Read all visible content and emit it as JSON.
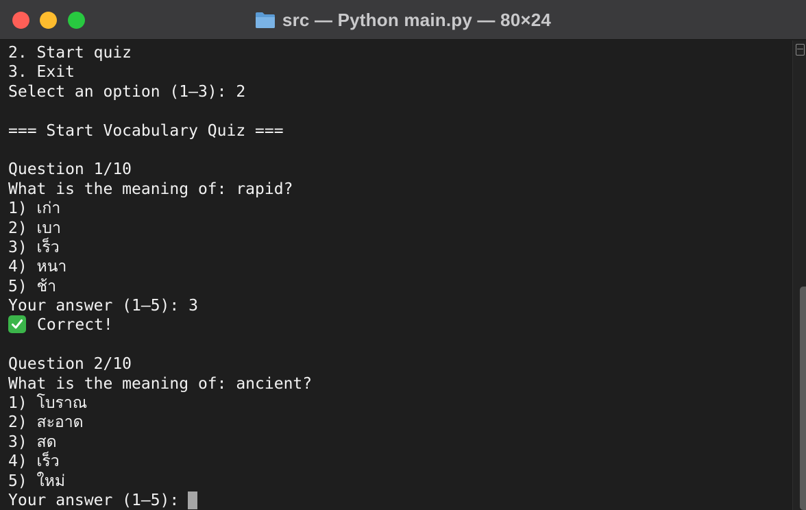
{
  "window": {
    "title": "src — Python main.py — 80×24",
    "icon": "folder-icon"
  },
  "colors": {
    "close": "#fe5f57",
    "minimize": "#febc2e",
    "zoom": "#28c840",
    "background": "#1e1e1e",
    "foreground": "#f2f2f2",
    "check": "#3bb54a"
  },
  "terminal": {
    "lines": [
      "2. Start quiz",
      "3. Exit",
      "Select an option (1–3): 2",
      "",
      "=== Start Vocabulary Quiz ===",
      "",
      "Question 1/10",
      "What is the meaning of: rapid?",
      "1) เก่า",
      "2) เบา",
      "3) เร็ว",
      "4) หนา",
      "5) ช้า",
      "Your answer (1–5): 3",
      "Correct!",
      "",
      "Question 2/10",
      "What is the meaning of: ancient?",
      "1) โบราณ",
      "2) สะอาด",
      "3) สด",
      "4) เร็ว",
      "5) ใหม่",
      "Your answer (1–5):"
    ]
  }
}
